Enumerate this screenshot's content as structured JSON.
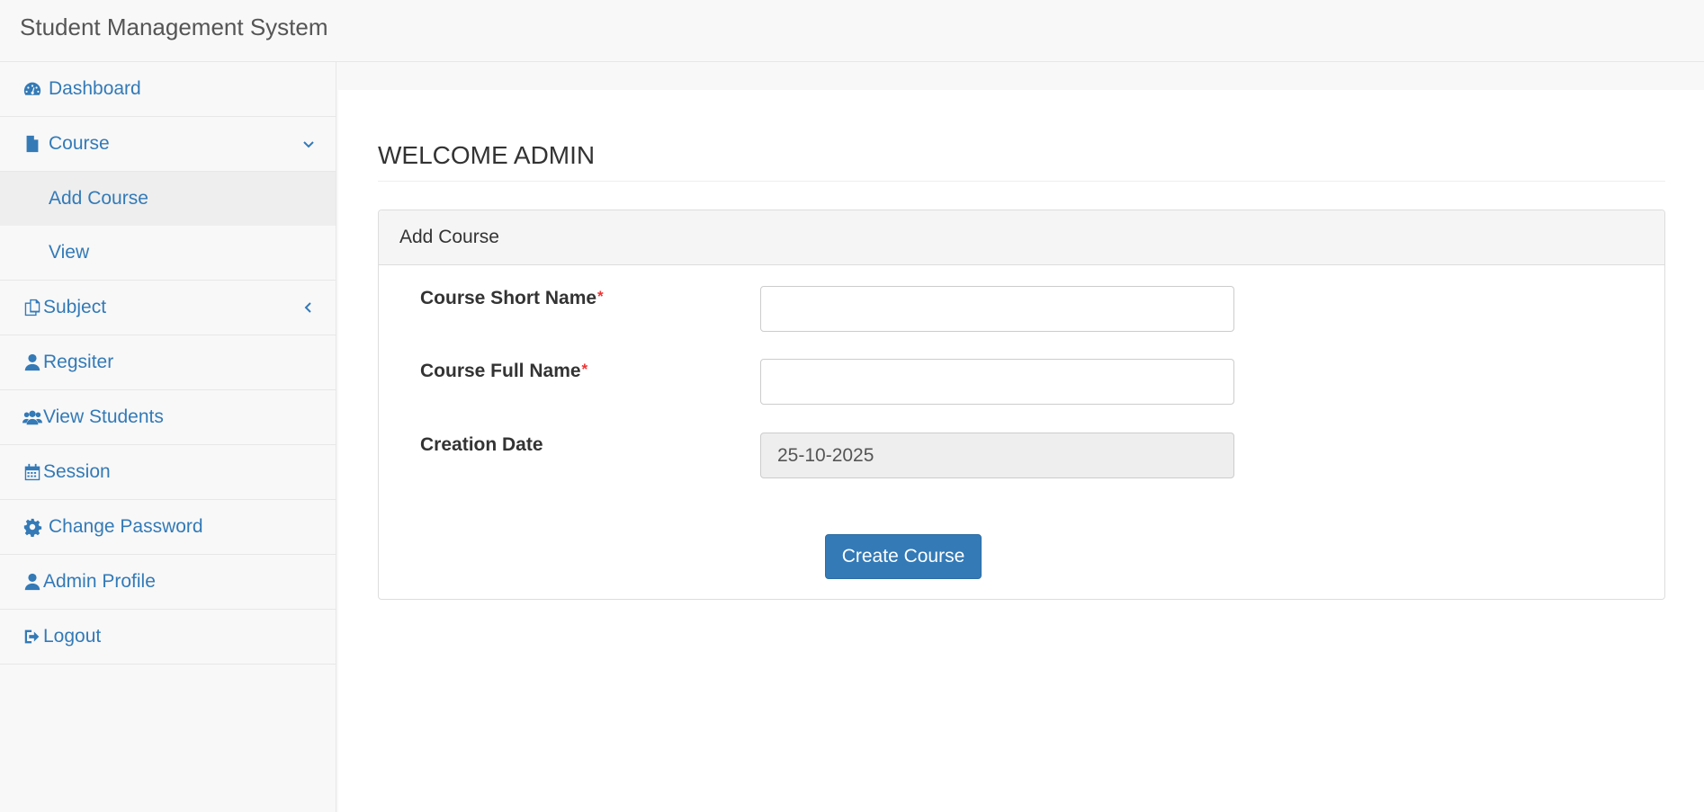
{
  "app": {
    "brand": "Student Management System"
  },
  "sidebar": {
    "items": [
      {
        "label": "Dashboard",
        "icon": "dashboard-icon"
      },
      {
        "label": "Course",
        "icon": "file-icon",
        "expanded": true,
        "children": [
          {
            "label": "Add Course",
            "active": true
          },
          {
            "label": "View"
          }
        ]
      },
      {
        "label": "Subject",
        "icon": "copy-icon",
        "expanded": false
      },
      {
        "label": "Regsiter",
        "icon": "user-icon"
      },
      {
        "label": "View Students",
        "icon": "users-icon"
      },
      {
        "label": "Session",
        "icon": "calendar-icon"
      },
      {
        "label": "Change Password",
        "icon": "gear-icon"
      },
      {
        "label": "Admin Profile",
        "icon": "user-icon"
      },
      {
        "label": "Logout",
        "icon": "sign-out-icon"
      }
    ]
  },
  "main": {
    "page_title": "WELCOME ADMIN",
    "panel_title": "Add Course",
    "form": {
      "short_name_label": "Course Short Name",
      "short_name_value": "",
      "full_name_label": "Course Full Name",
      "full_name_value": "",
      "required_mark": "*",
      "creation_date_label": "Creation Date",
      "creation_date_value": "25-10-2025",
      "submit_label": "Create Course"
    }
  },
  "colors": {
    "link": "#337ab7",
    "required": "#e33333",
    "primary_button": "#337ab7"
  }
}
